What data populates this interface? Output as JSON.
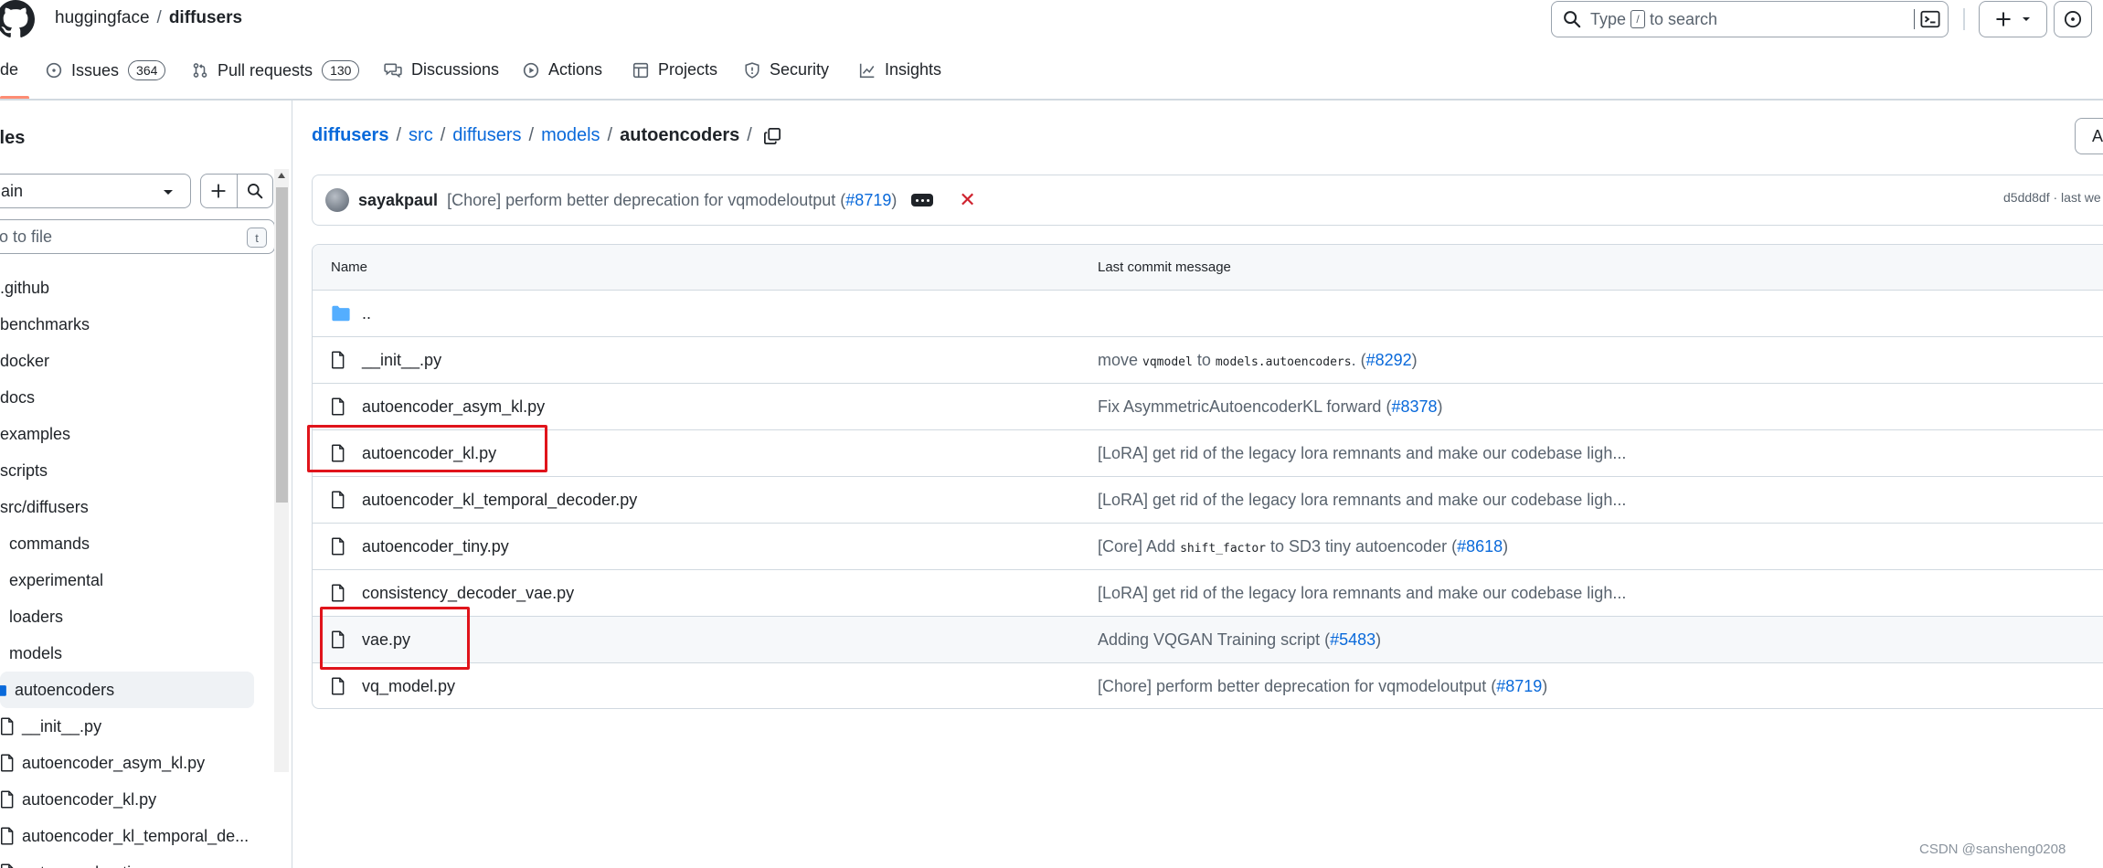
{
  "header": {
    "owner": "huggingface",
    "separator": "/",
    "repo": "diffusers",
    "search_prefix": "Type",
    "search_key": "/",
    "search_suffix": "to search"
  },
  "nav": {
    "code_label": "de",
    "issues_label": "Issues",
    "issues_count": "364",
    "pulls_label": "Pull requests",
    "pulls_count": "130",
    "discussions_label": "Discussions",
    "actions_label": "Actions",
    "projects_label": "Projects",
    "security_label": "Security",
    "insights_label": "Insights"
  },
  "sidebar": {
    "title": "iles",
    "branch": "ain",
    "go_to_file": "o to file",
    "go_to_file_key": "t",
    "tree": [
      {
        "label": ".github",
        "indent": 0,
        "kind": "plain"
      },
      {
        "label": "benchmarks",
        "indent": 0,
        "kind": "plain"
      },
      {
        "label": "docker",
        "indent": 0,
        "kind": "plain"
      },
      {
        "label": "docs",
        "indent": 0,
        "kind": "plain"
      },
      {
        "label": "examples",
        "indent": 0,
        "kind": "plain"
      },
      {
        "label": "scripts",
        "indent": 0,
        "kind": "plain"
      },
      {
        "label": "src/diffusers",
        "indent": 0,
        "kind": "plain"
      },
      {
        "label": "commands",
        "indent": 1,
        "kind": "plain"
      },
      {
        "label": "experimental",
        "indent": 1,
        "kind": "plain"
      },
      {
        "label": "loaders",
        "indent": 1,
        "kind": "plain"
      },
      {
        "label": "models",
        "indent": 1,
        "kind": "plain"
      },
      {
        "label": "autoencoders",
        "indent": 2,
        "kind": "folder-selected"
      },
      {
        "label": "__init__.py",
        "indent": 3,
        "kind": "file"
      },
      {
        "label": "autoencoder_asym_kl.py",
        "indent": 3,
        "kind": "file"
      },
      {
        "label": "autoencoder_kl.py",
        "indent": 3,
        "kind": "file"
      },
      {
        "label": "autoencoder_kl_temporal_de...",
        "indent": 3,
        "kind": "file"
      },
      {
        "label": "autoencoder_tiny.py",
        "indent": 3,
        "kind": "file"
      }
    ]
  },
  "main": {
    "breadcrumb": {
      "root": "diffusers",
      "p1": "src",
      "p2": "diffusers",
      "p3": "models",
      "current": "autoencoders",
      "separator": "/"
    },
    "add_file_label": "Ad",
    "commit": {
      "author": "sayakpaul",
      "message_prefix": "[Chore] perform better deprecation for vqmodeloutput (",
      "pr": "#8719",
      "message_suffix": ")",
      "fail_mark": "✕",
      "sha": "d5dd8df · last we"
    },
    "table": {
      "col_name": "Name",
      "col_msg": "Last commit message",
      "parent": "..",
      "rows": [
        {
          "name": "__init__.py",
          "msg_parts": [
            "move ",
            "vqmodel",
            " to ",
            "models.autoencoders",
            ". (",
            "#8292",
            ")"
          ]
        },
        {
          "name": "autoencoder_asym_kl.py",
          "msg_parts": [
            "Fix AsymmetricAutoencoderKL forward (",
            "#8378",
            ")"
          ]
        },
        {
          "name": "autoencoder_kl.py",
          "msg_parts": [
            "[LoRA] get rid of the legacy lora remnants and make our codebase ligh..."
          ]
        },
        {
          "name": "autoencoder_kl_temporal_decoder.py",
          "msg_parts": [
            "[LoRA] get rid of the legacy lora remnants and make our codebase ligh..."
          ]
        },
        {
          "name": "autoencoder_tiny.py",
          "msg_parts": [
            "[Core] Add ",
            "shift_factor",
            " to SD3 tiny autoencoder (",
            "#8618",
            ")"
          ]
        },
        {
          "name": "consistency_decoder_vae.py",
          "msg_parts": [
            "[LoRA] get rid of the legacy lora remnants and make our codebase ligh..."
          ]
        },
        {
          "name": "vae.py",
          "msg_parts": [
            "Adding VQGAN Training script (",
            "#5483",
            ")"
          ]
        },
        {
          "name": "vq_model.py",
          "msg_parts": [
            "[Chore] perform better deprecation for vqmodeloutput (",
            "#8719",
            ")"
          ]
        }
      ]
    }
  },
  "watermark": "CSDN @sansheng0208",
  "colors": {
    "link": "#0969da",
    "highlight": "#e0141b",
    "folder": "#54aeff",
    "underline": "#fd8c73"
  }
}
